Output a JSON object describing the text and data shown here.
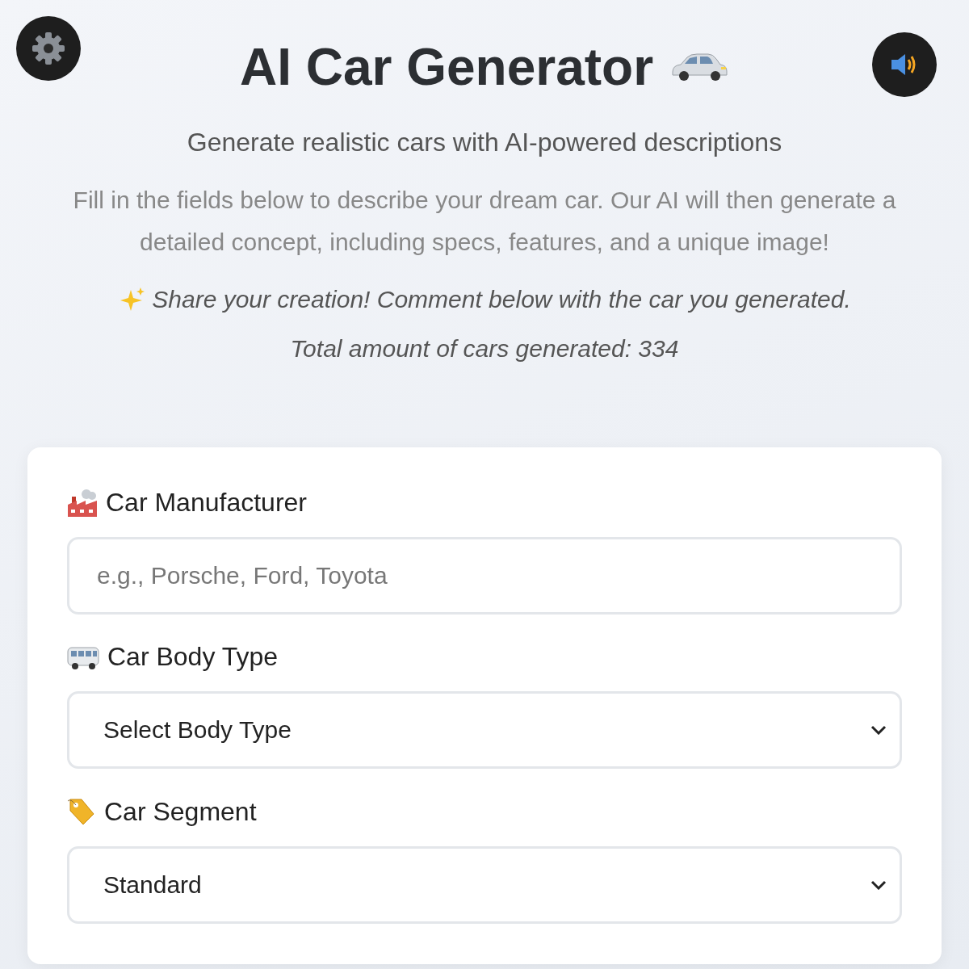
{
  "header": {
    "title": "AI Car Generator",
    "subtitle": "Generate realistic cars with AI-powered descriptions",
    "description": "Fill in the fields below to describe your dream car. Our AI will then generate a detailed concept, including specs, features, and a unique image!",
    "share_note": "Share your creation! Comment below with the car you generated.",
    "total": "Total amount of cars generated: 334"
  },
  "form": {
    "fields": [
      {
        "kind": "text",
        "label": "Car Manufacturer",
        "placeholder": "e.g., Porsche, Ford, Toyota"
      },
      {
        "kind": "select",
        "label": "Car Body Type",
        "value": "Select Body Type"
      },
      {
        "kind": "select",
        "label": "Car Segment",
        "value": "Standard"
      }
    ]
  }
}
